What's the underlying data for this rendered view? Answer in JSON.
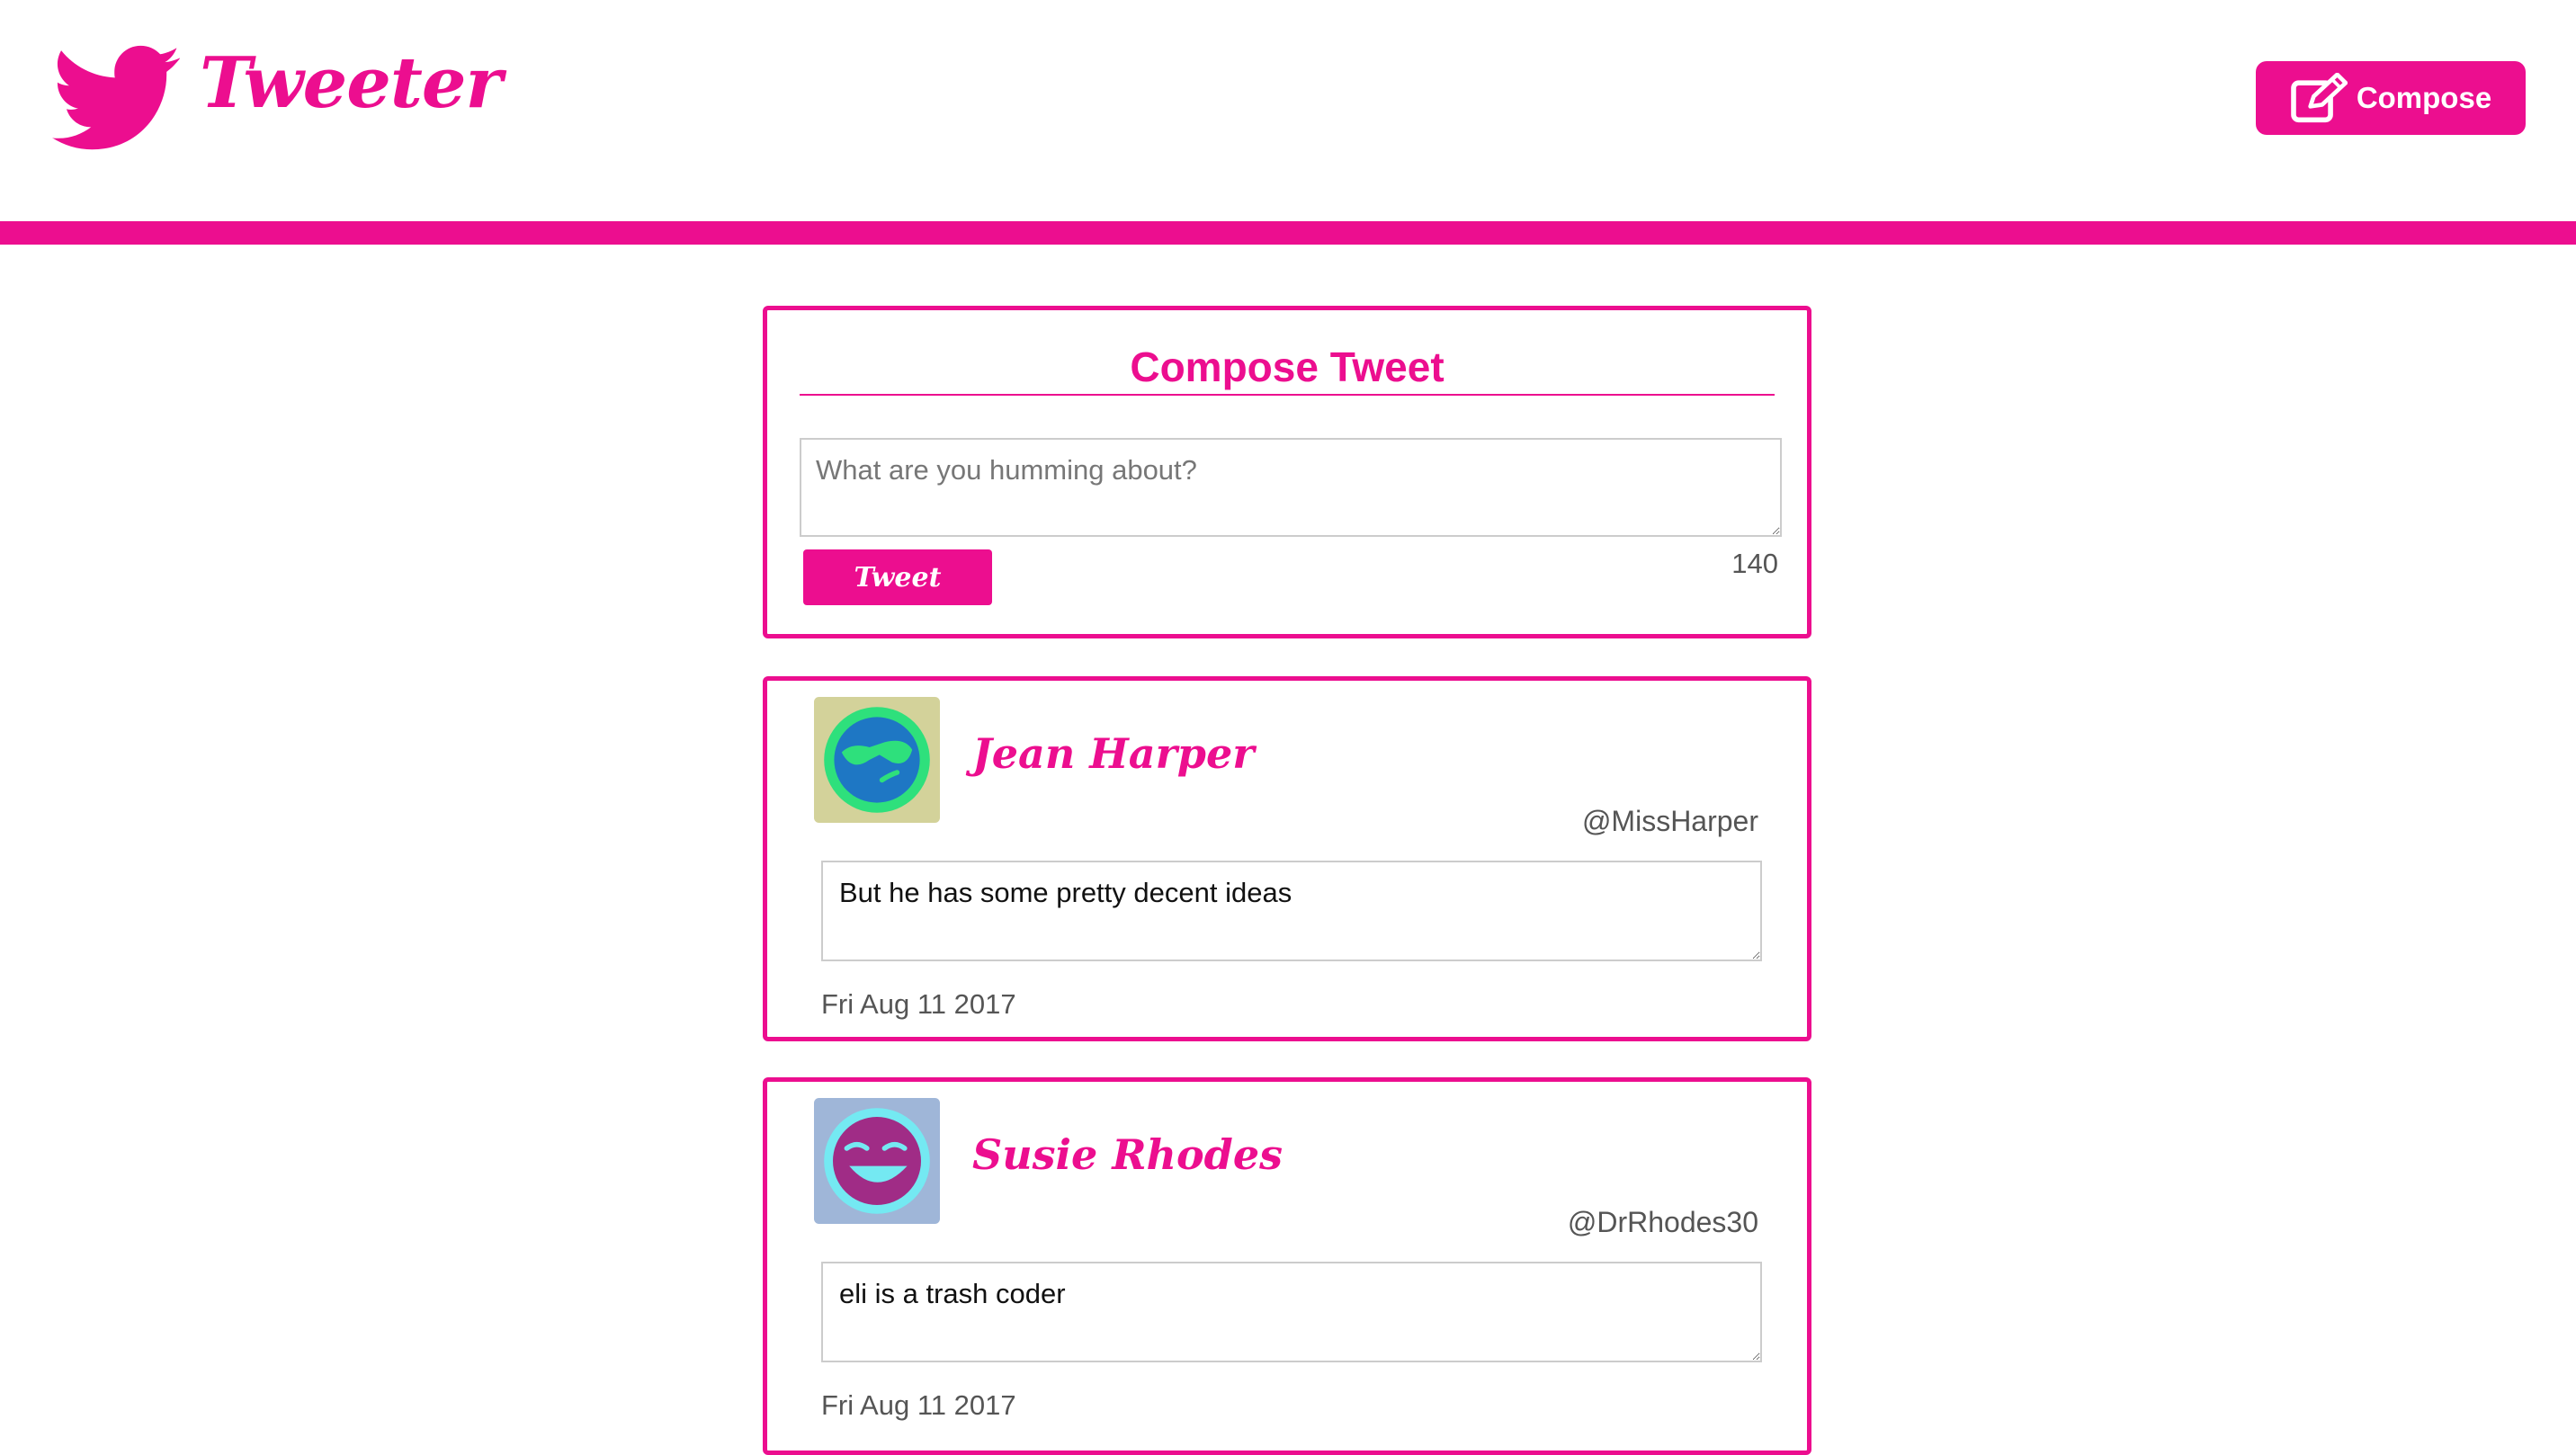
{
  "header": {
    "app_name": "Tweeter",
    "compose_label": "Compose",
    "brand_color": "#ec0e8f"
  },
  "compose": {
    "title": "Compose Tweet",
    "placeholder": "What are you humming about?",
    "tweet_button_label": "Tweet",
    "char_counter": "140"
  },
  "tweets": [
    {
      "name": "Jean Harper",
      "handle": "@MissHarper",
      "content": "But he has some pretty decent ideas",
      "date": "Fri Aug 11 2017",
      "avatar_icon": "sunglasses-face-avatar"
    },
    {
      "name": "Susie Rhodes",
      "handle": "@DrRhodes30",
      "content": "eli is a trash coder",
      "date": "Fri Aug 11 2017",
      "avatar_icon": "laughing-face-avatar"
    }
  ]
}
